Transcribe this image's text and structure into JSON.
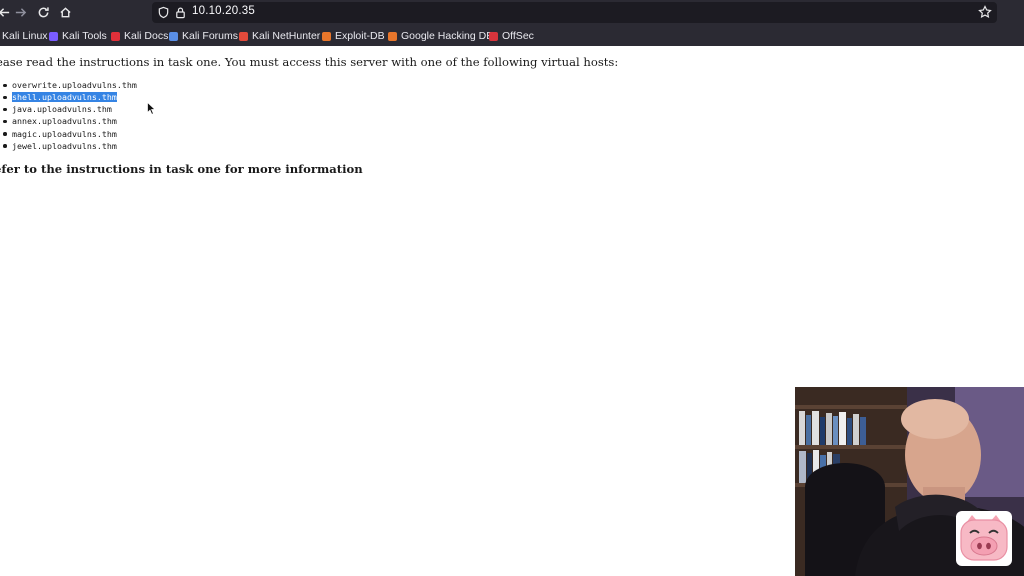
{
  "browser": {
    "url": "10.10.20.35",
    "bookmarks": [
      {
        "label": "Kali Linux",
        "color": "#367bf0"
      },
      {
        "label": "Kali Tools",
        "color": "#7a5cff"
      },
      {
        "label": "Kali Docs",
        "color": "#e0303a"
      },
      {
        "label": "Kali Forums",
        "color": "#5a8fe6"
      },
      {
        "label": "Kali NetHunter",
        "color": "#e24a3b"
      },
      {
        "label": "Exploit-DB",
        "color": "#e8762b"
      },
      {
        "label": "Google Hacking DB",
        "color": "#e8762b"
      },
      {
        "label": "OffSec",
        "color": "#d8343c"
      }
    ]
  },
  "page": {
    "intro": "ease read the instructions in task one. You must access this server with one of the following virtual hosts:",
    "hosts": [
      "overwrite.uploadvulns.thm",
      "shell.uploadvulns.thm",
      "java.uploadvulns.thm",
      "annex.uploadvulns.thm",
      "magic.uploadvulns.thm",
      "jewel.uploadvulns.thm"
    ],
    "selected_host_index": 1,
    "footer_note": "efer to the instructions in task one for more information"
  },
  "colors": {
    "chrome": "#2b2a33",
    "urlbar": "#1c1b22",
    "selection": "#3584e4"
  }
}
